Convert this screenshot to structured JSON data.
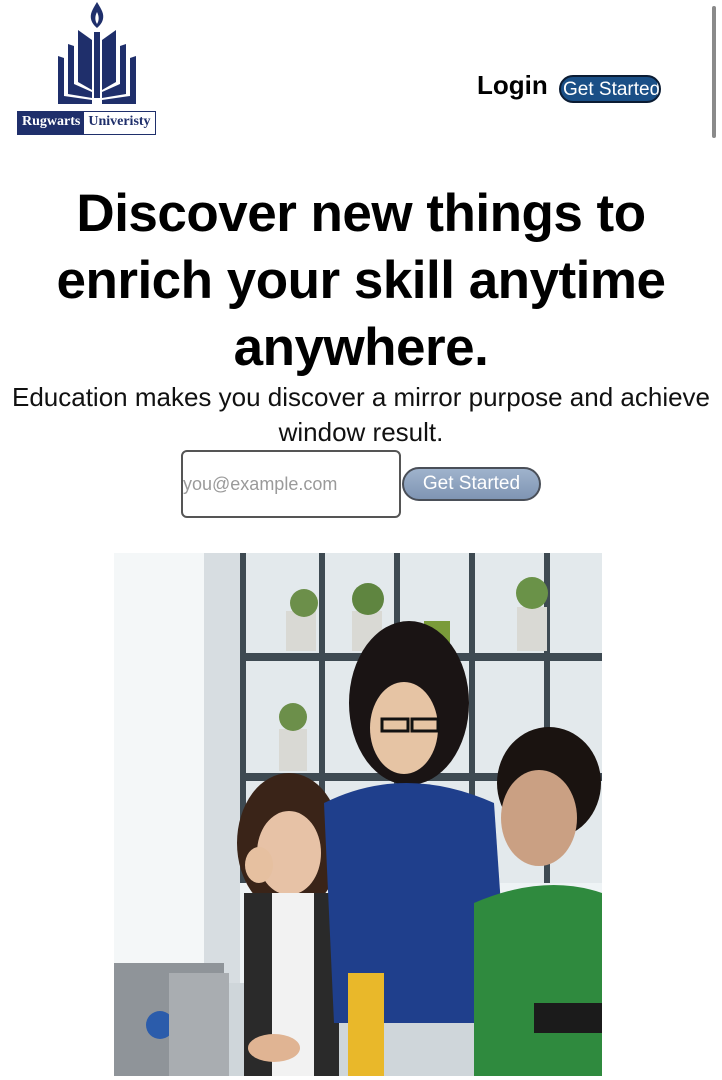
{
  "brand": {
    "name_part1": "Rugwarts",
    "name_part2": "Univeristy",
    "logo_icon": "book-flame-emblem-icon",
    "primary_color": "#1f2f6b"
  },
  "nav": {
    "login_label": "Login",
    "cta_label": "Get Started",
    "cta_color": "#1a4f86"
  },
  "hero": {
    "title": "Discover new things to enrich your skill anytime anywhere.",
    "subtitle": "Education makes you discover a mirror purpose and achieve window result.",
    "email_placeholder": "you@example.com",
    "cta_label": "Get Started"
  },
  "hero_image": {
    "icon": "students-collaborating-photo"
  }
}
